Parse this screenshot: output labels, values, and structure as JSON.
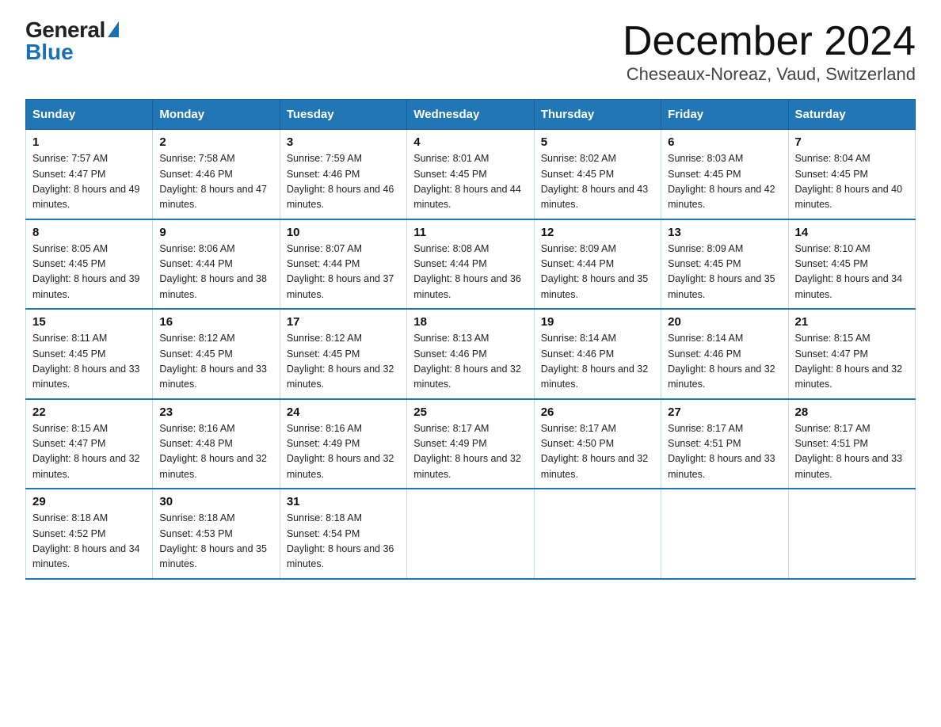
{
  "logo": {
    "general": "General",
    "blue": "Blue"
  },
  "title": "December 2024",
  "location": "Cheseaux-Noreaz, Vaud, Switzerland",
  "headers": [
    "Sunday",
    "Monday",
    "Tuesday",
    "Wednesday",
    "Thursday",
    "Friday",
    "Saturday"
  ],
  "weeks": [
    [
      {
        "day": "1",
        "sunrise": "7:57 AM",
        "sunset": "4:47 PM",
        "daylight": "8 hours and 49 minutes."
      },
      {
        "day": "2",
        "sunrise": "7:58 AM",
        "sunset": "4:46 PM",
        "daylight": "8 hours and 47 minutes."
      },
      {
        "day": "3",
        "sunrise": "7:59 AM",
        "sunset": "4:46 PM",
        "daylight": "8 hours and 46 minutes."
      },
      {
        "day": "4",
        "sunrise": "8:01 AM",
        "sunset": "4:45 PM",
        "daylight": "8 hours and 44 minutes."
      },
      {
        "day": "5",
        "sunrise": "8:02 AM",
        "sunset": "4:45 PM",
        "daylight": "8 hours and 43 minutes."
      },
      {
        "day": "6",
        "sunrise": "8:03 AM",
        "sunset": "4:45 PM",
        "daylight": "8 hours and 42 minutes."
      },
      {
        "day": "7",
        "sunrise": "8:04 AM",
        "sunset": "4:45 PM",
        "daylight": "8 hours and 40 minutes."
      }
    ],
    [
      {
        "day": "8",
        "sunrise": "8:05 AM",
        "sunset": "4:45 PM",
        "daylight": "8 hours and 39 minutes."
      },
      {
        "day": "9",
        "sunrise": "8:06 AM",
        "sunset": "4:44 PM",
        "daylight": "8 hours and 38 minutes."
      },
      {
        "day": "10",
        "sunrise": "8:07 AM",
        "sunset": "4:44 PM",
        "daylight": "8 hours and 37 minutes."
      },
      {
        "day": "11",
        "sunrise": "8:08 AM",
        "sunset": "4:44 PM",
        "daylight": "8 hours and 36 minutes."
      },
      {
        "day": "12",
        "sunrise": "8:09 AM",
        "sunset": "4:44 PM",
        "daylight": "8 hours and 35 minutes."
      },
      {
        "day": "13",
        "sunrise": "8:09 AM",
        "sunset": "4:45 PM",
        "daylight": "8 hours and 35 minutes."
      },
      {
        "day": "14",
        "sunrise": "8:10 AM",
        "sunset": "4:45 PM",
        "daylight": "8 hours and 34 minutes."
      }
    ],
    [
      {
        "day": "15",
        "sunrise": "8:11 AM",
        "sunset": "4:45 PM",
        "daylight": "8 hours and 33 minutes."
      },
      {
        "day": "16",
        "sunrise": "8:12 AM",
        "sunset": "4:45 PM",
        "daylight": "8 hours and 33 minutes."
      },
      {
        "day": "17",
        "sunrise": "8:12 AM",
        "sunset": "4:45 PM",
        "daylight": "8 hours and 32 minutes."
      },
      {
        "day": "18",
        "sunrise": "8:13 AM",
        "sunset": "4:46 PM",
        "daylight": "8 hours and 32 minutes."
      },
      {
        "day": "19",
        "sunrise": "8:14 AM",
        "sunset": "4:46 PM",
        "daylight": "8 hours and 32 minutes."
      },
      {
        "day": "20",
        "sunrise": "8:14 AM",
        "sunset": "4:46 PM",
        "daylight": "8 hours and 32 minutes."
      },
      {
        "day": "21",
        "sunrise": "8:15 AM",
        "sunset": "4:47 PM",
        "daylight": "8 hours and 32 minutes."
      }
    ],
    [
      {
        "day": "22",
        "sunrise": "8:15 AM",
        "sunset": "4:47 PM",
        "daylight": "8 hours and 32 minutes."
      },
      {
        "day": "23",
        "sunrise": "8:16 AM",
        "sunset": "4:48 PM",
        "daylight": "8 hours and 32 minutes."
      },
      {
        "day": "24",
        "sunrise": "8:16 AM",
        "sunset": "4:49 PM",
        "daylight": "8 hours and 32 minutes."
      },
      {
        "day": "25",
        "sunrise": "8:17 AM",
        "sunset": "4:49 PM",
        "daylight": "8 hours and 32 minutes."
      },
      {
        "day": "26",
        "sunrise": "8:17 AM",
        "sunset": "4:50 PM",
        "daylight": "8 hours and 32 minutes."
      },
      {
        "day": "27",
        "sunrise": "8:17 AM",
        "sunset": "4:51 PM",
        "daylight": "8 hours and 33 minutes."
      },
      {
        "day": "28",
        "sunrise": "8:17 AM",
        "sunset": "4:51 PM",
        "daylight": "8 hours and 33 minutes."
      }
    ],
    [
      {
        "day": "29",
        "sunrise": "8:18 AM",
        "sunset": "4:52 PM",
        "daylight": "8 hours and 34 minutes."
      },
      {
        "day": "30",
        "sunrise": "8:18 AM",
        "sunset": "4:53 PM",
        "daylight": "8 hours and 35 minutes."
      },
      {
        "day": "31",
        "sunrise": "8:18 AM",
        "sunset": "4:54 PM",
        "daylight": "8 hours and 36 minutes."
      },
      null,
      null,
      null,
      null
    ]
  ]
}
